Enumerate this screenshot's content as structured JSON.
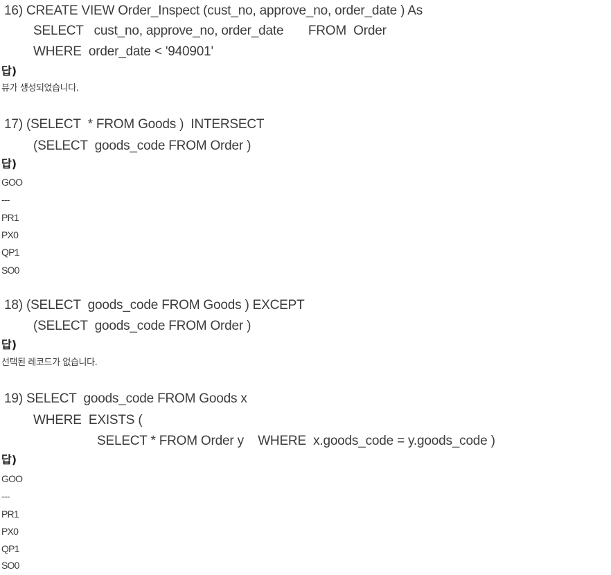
{
  "q16": {
    "lines": [
      "16) CREATE VIEW Order_Inspect (cust_no, approve_no, order_date ) As",
      "SELECT   cust_no, approve_no, order_date       FROM  Order",
      "WHERE  order_date < '940901'"
    ],
    "answer_label": "답)",
    "answer_text": "뷰가 생성되었습니다."
  },
  "q17": {
    "lines": [
      "17) (SELECT  * FROM Goods )  INTERSECT",
      "(SELECT  goods_code FROM Order )"
    ],
    "answer_label": "답)",
    "result_lines": [
      "GOO",
      "---",
      "PR1",
      "PX0",
      "QP1",
      "SO0"
    ]
  },
  "q18": {
    "lines": [
      "18) (SELECT  goods_code FROM Goods ) EXCEPT",
      "(SELECT  goods_code FROM Order )"
    ],
    "answer_label": "답)",
    "answer_text": "선택된 레코드가 없습니다."
  },
  "q19": {
    "lines": [
      "19) SELECT  goods_code FROM Goods x",
      "WHERE  EXISTS (",
      "SELECT * FROM Order y    WHERE  x.goods_code = y.goods_code )"
    ],
    "answer_label": "답)",
    "result_lines": [
      "GOO",
      "---",
      "PR1",
      "PX0",
      "QP1",
      "SO0"
    ]
  }
}
